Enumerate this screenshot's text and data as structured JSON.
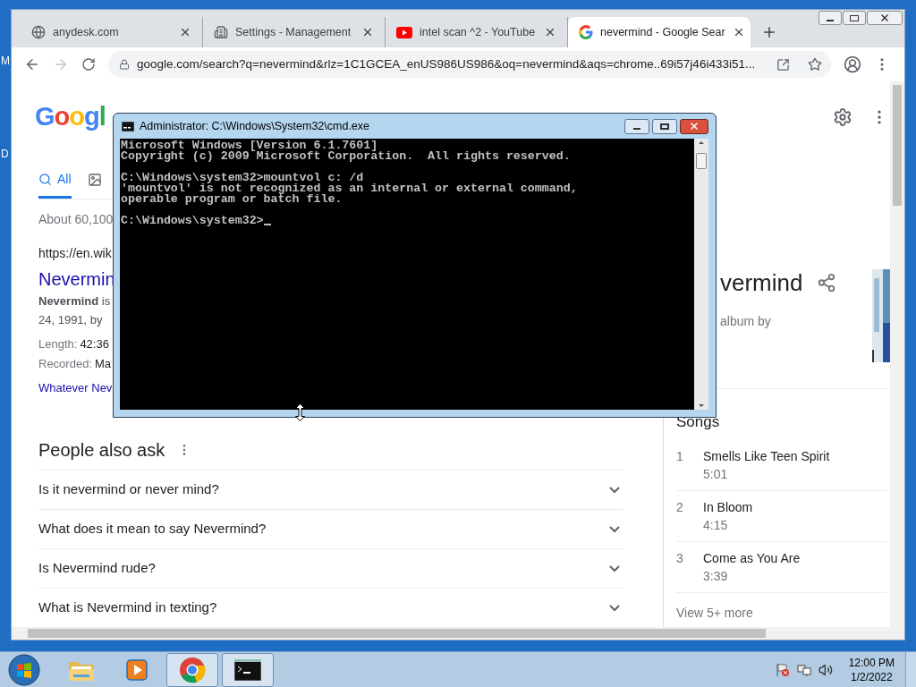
{
  "desktop": {
    "icon_labels": [
      "M",
      "D"
    ]
  },
  "browser": {
    "tabs": [
      {
        "title": "anydesk.com",
        "kind": "globe",
        "selected": false
      },
      {
        "title": "Settings - Management",
        "kind": "building",
        "selected": false
      },
      {
        "title": "intel scan ^2 - YouTube",
        "kind": "youtube",
        "selected": false
      },
      {
        "title": "nevermind - Google Sear",
        "kind": "google",
        "selected": true
      }
    ],
    "address": "google.com/search?q=nevermind&rlz=1C1GCEA_enUS986US986&oq=nevermind&aqs=chrome..69i57j46i433i51...",
    "page": {
      "logo": "Googl",
      "search_tabs": [
        {
          "label": "All",
          "kind": "search",
          "selected": true
        },
        {
          "kind": "images",
          "selected": false
        }
      ],
      "result_stats": "About 60,100",
      "result": {
        "url": "https://en.wik",
        "title": "Nevermin",
        "snippet": [
          "**Nevermind** is",
          "24, 1991, by"
        ],
        "facts": [
          {
            "label": "Length:",
            "value": "42:36"
          },
          {
            "label": "Recorded:",
            "value": "Ma"
          }
        ],
        "link": "Whatever Nev"
      },
      "people_also_ask": {
        "heading": "People also ask",
        "questions": [
          "Is it nevermind or never mind?",
          "What does it mean to say Nevermind?",
          "Is Nevermind rude?",
          "What is Nevermind in texting?"
        ]
      },
      "knowledge_panel": {
        "title": "vermind",
        "subtitle": "album by",
        "songs_heading": "Songs",
        "songs": [
          {
            "number": "1",
            "title": "Smells Like Teen Spirit",
            "duration": "5:01"
          },
          {
            "number": "2",
            "title": "In Bloom",
            "duration": "4:15"
          },
          {
            "number": "3",
            "title": "Come as You Are",
            "duration": "3:39"
          }
        ],
        "more": "View 5+ more"
      }
    }
  },
  "cmd": {
    "title": "Administrator: C:\\Windows\\System32\\cmd.exe",
    "blocks": [
      [
        "Microsoft Windows [Version 6.1.7601]",
        "Copyright (c) 2009 Microsoft Corporation.  All rights reserved."
      ],
      [
        "C:\\Windows\\system32>mountvol c: /d",
        "'mountvol' is not recognized as an internal or external command,",
        "operable program or batch file."
      ],
      [
        "C:\\Windows\\system32>"
      ]
    ]
  },
  "taskbar": {
    "apps": [
      {
        "kind": "explorer",
        "active": false
      },
      {
        "kind": "media",
        "active": false
      },
      {
        "kind": "chrome",
        "active": true
      },
      {
        "kind": "cmd",
        "active": true
      }
    ],
    "clock": {
      "time": "12:00 PM",
      "date": "1/2/2022"
    }
  }
}
